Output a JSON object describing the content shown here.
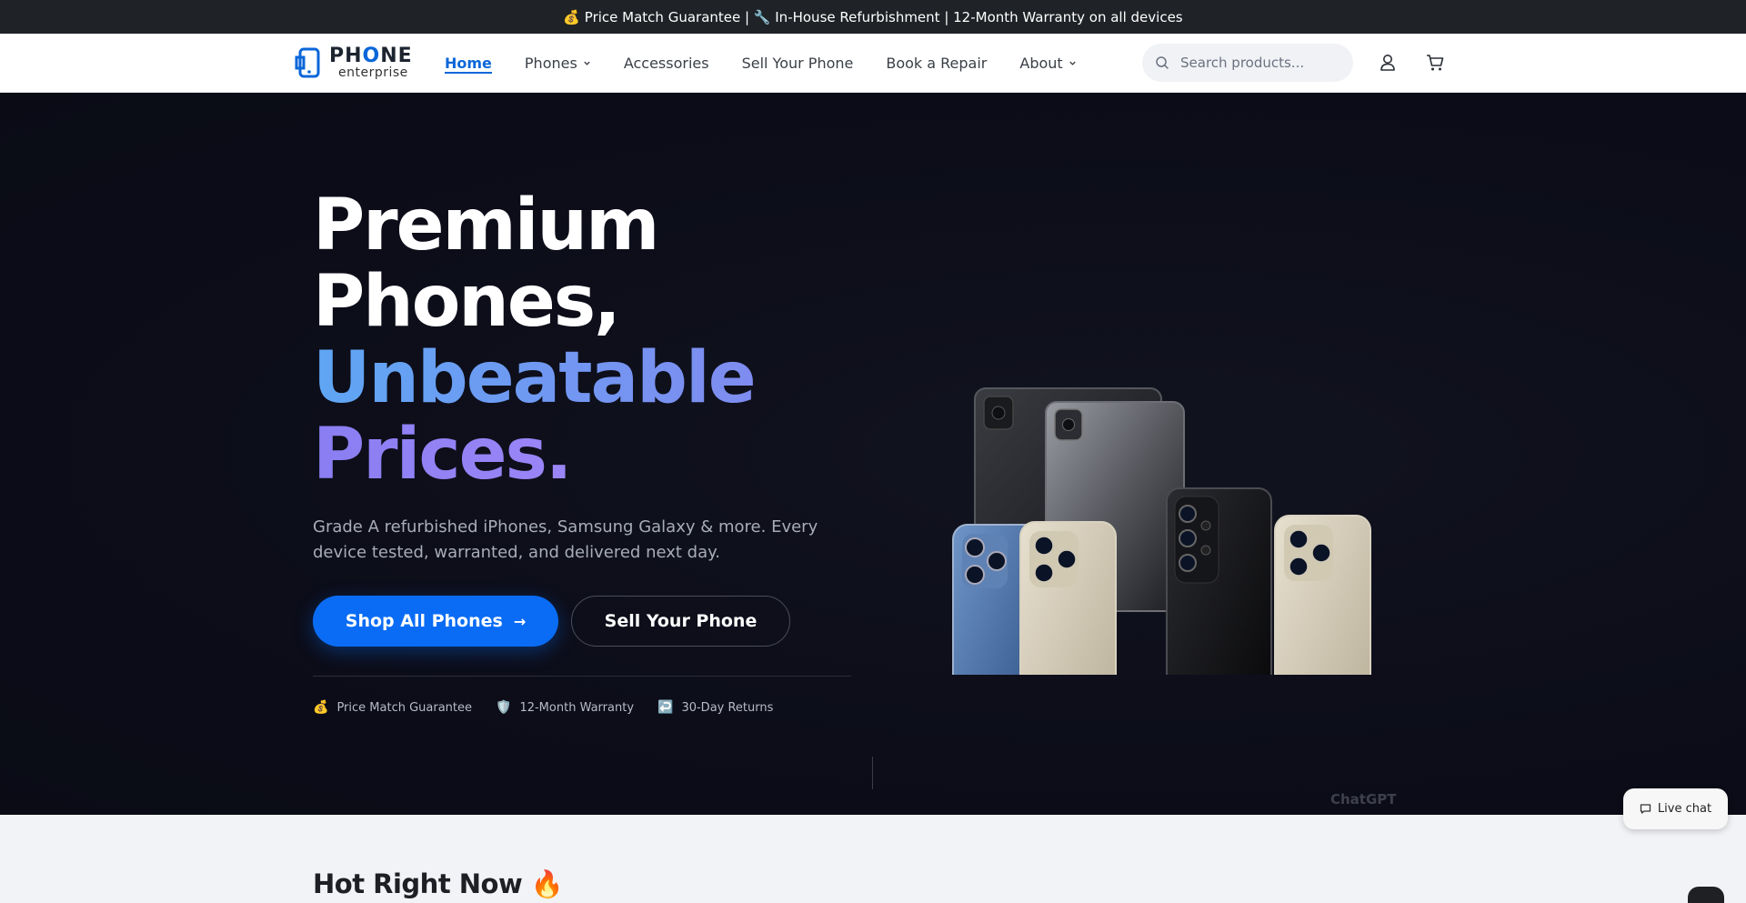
{
  "announcement": "💰 Price Match Guarantee | 🔧 In-House Refurbishment | 12-Month Warranty on all devices",
  "logo": {
    "word_pre": "PH",
    "word_o": "O",
    "word_post": "NE",
    "sub": "enterprise"
  },
  "nav": [
    {
      "label": "Home",
      "active": true
    },
    {
      "label": "Phones",
      "dropdown": true
    },
    {
      "label": "Accessories"
    },
    {
      "label": "Sell Your Phone"
    },
    {
      "label": "Book a Repair"
    },
    {
      "label": "About",
      "dropdown": true
    }
  ],
  "search": {
    "placeholder": "Search products..."
  },
  "header_icons": [
    "user-icon",
    "cart-icon"
  ],
  "hero": {
    "line1": "Premium",
    "line2": "Phones,",
    "line3": "Unbeatable",
    "line4": "Prices.",
    "subtitle": "Grade A refurbished iPhones, Samsung Galaxy & more. Every device tested, warranted, and delivered next day.",
    "primary_button": "Shop All Phones",
    "secondary_button": "Sell Your Phone",
    "features": [
      {
        "icon": "💰",
        "label": "Price Match Guarantee"
      },
      {
        "icon": "🛡️",
        "label": "12-Month Warranty"
      },
      {
        "icon": "↩️",
        "label": "30-Day Returns"
      }
    ],
    "watermark": "ChatGPT"
  },
  "section": {
    "title": "Hot Right Now 🔥"
  },
  "live_chat": {
    "label": "Live chat"
  },
  "colors": {
    "accent": "#0a6cf5",
    "hero_bg": "#0c0d19",
    "gradient_start": "#5fa6f4",
    "gradient_end": "#a78bfa"
  }
}
